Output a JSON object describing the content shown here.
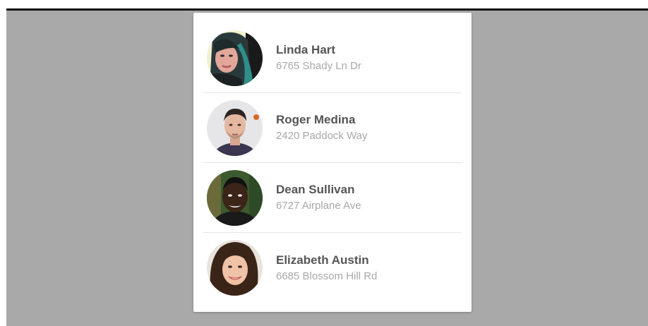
{
  "contacts": [
    {
      "name": "Linda Hart",
      "address": "6765 Shady Ln Dr"
    },
    {
      "name": "Roger Medina",
      "address": "2420 Paddock Way"
    },
    {
      "name": "Dean Sullivan",
      "address": "6727 Airplane Ave"
    },
    {
      "name": "Elizabeth Austin",
      "address": "6685 Blossom Hill Rd"
    }
  ],
  "colors": {
    "background": "#a9a9a9",
    "card": "#ffffff",
    "name_text": "#555555",
    "address_text": "#a8a8a8",
    "divider": "#e6e6e6"
  }
}
